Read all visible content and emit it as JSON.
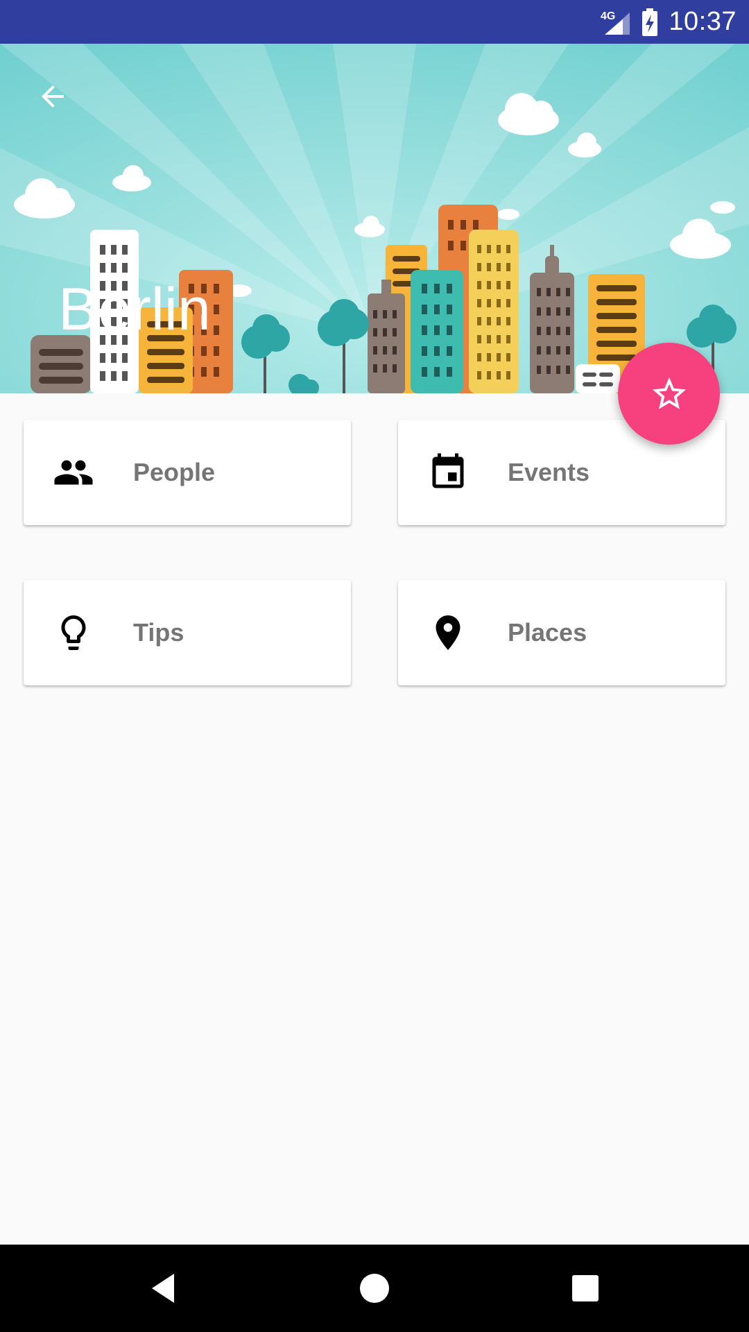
{
  "status_bar": {
    "time": "10:37",
    "network": "4G",
    "icons": [
      "signal-icon",
      "battery-charging-icon"
    ]
  },
  "header": {
    "title": "Berlin",
    "back_icon": "arrow-back-icon"
  },
  "fab": {
    "icon": "star-outline-icon",
    "color": "#f7407e"
  },
  "cards": [
    {
      "label": "People",
      "icon": "people-icon"
    },
    {
      "label": "Events",
      "icon": "event-icon"
    },
    {
      "label": "Tips",
      "icon": "lightbulb-icon"
    },
    {
      "label": "Places",
      "icon": "place-icon"
    }
  ],
  "nav_bar": {
    "buttons": [
      "back-nav",
      "home-nav",
      "recents-nav"
    ]
  },
  "colors": {
    "status_bar": "#303f9f",
    "sky": "#7fd3d3",
    "accent": "#f7407e",
    "card_label": "#757575"
  }
}
